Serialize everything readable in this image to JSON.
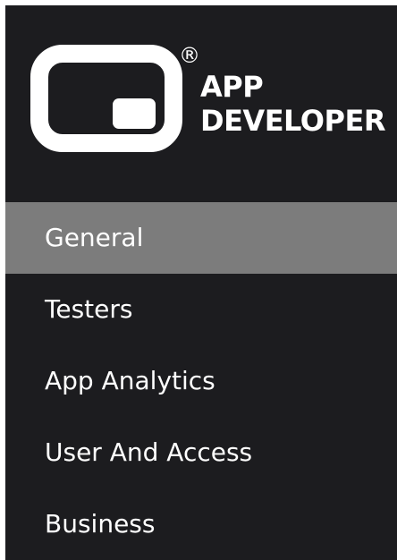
{
  "brand": {
    "line1": "APP",
    "line2": "DEVELOPER",
    "registered": "®",
    "icon": "app-window-logo-icon"
  },
  "nav": {
    "items": [
      {
        "label": "General",
        "active": true
      },
      {
        "label": "Testers",
        "active": false
      },
      {
        "label": "App Analytics",
        "active": false
      },
      {
        "label": "User And Access",
        "active": false
      },
      {
        "label": "Business",
        "active": false
      }
    ]
  },
  "colors": {
    "sidebar_bg": "#1c1c1f",
    "active_bg": "#7c7c7c",
    "text": "#ffffff"
  }
}
